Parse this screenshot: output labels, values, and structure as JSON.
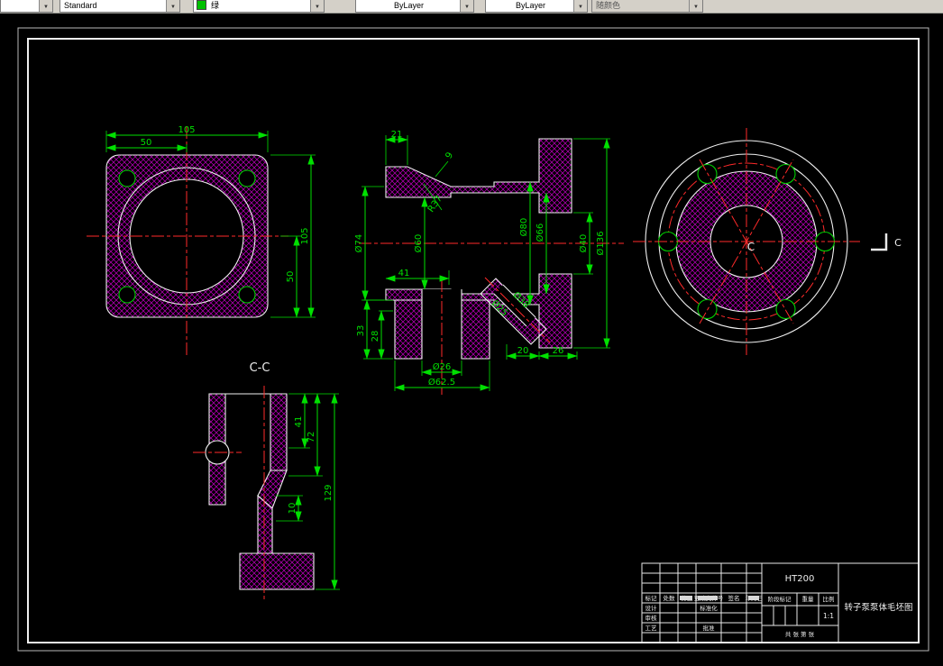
{
  "toolbar": {
    "layer_value": "",
    "style_value": "Standard",
    "color_value": "绿",
    "linetype_value": "ByLayer",
    "lineweight_value": "ByLayer",
    "plotstyle_value": "随颜色",
    "arrow": "▼"
  },
  "colors": {
    "dimension": "#00e000",
    "hatch": "#c000c0",
    "centerline": "#ff2a2a",
    "geometry": "#f0f0f0",
    "color_swatch": "#00c000"
  },
  "drawing": {
    "front_view": {
      "dim_width_total": "105",
      "dim_width_half": "50",
      "dim_height_total": "105",
      "dim_height_half": "50"
    },
    "section_view": {
      "dim_21": "21",
      "dim_9": "9",
      "dim_r37": "R37",
      "dim_d74": "Ø74",
      "dim_41": "41",
      "dim_d60": "Ø60",
      "dim_d80": "Ø80",
      "dim_d66": "Ø66",
      "dim_d40": "Ø40",
      "dim_d136": "Ø136",
      "dim_33": "33",
      "dim_28": "28",
      "dim_d26": "Ø26",
      "dim_d62_5": "Ø62.5",
      "dim_20": "20",
      "dim_26b": "26",
      "dim_arm_bore": "Ø25",
      "dim_arm_od": "Ø38"
    },
    "end_view": {
      "section_label_center": "C",
      "section_label_right": "C"
    },
    "cc_view": {
      "title": "C-C",
      "dim_41": "41",
      "dim_72": "72",
      "dim_129": "129",
      "dim_10": "10"
    }
  },
  "title_block": {
    "material": "HT200",
    "drawing_title": "转子泵泵体毛坯图",
    "scale_value": "1:1",
    "labels": {
      "mark": "标记",
      "count": "处数",
      "zone": "分区",
      "change_file": "更改文件号",
      "signature": "签名",
      "date": "年月日",
      "design": "设计",
      "standardization": "标准化",
      "review": "审核",
      "process": "工艺",
      "approve": "批准",
      "stage_mark": "阶段标记",
      "weight": "重量",
      "scale": "比例",
      "sheet_info": "共 张 第 张"
    }
  }
}
